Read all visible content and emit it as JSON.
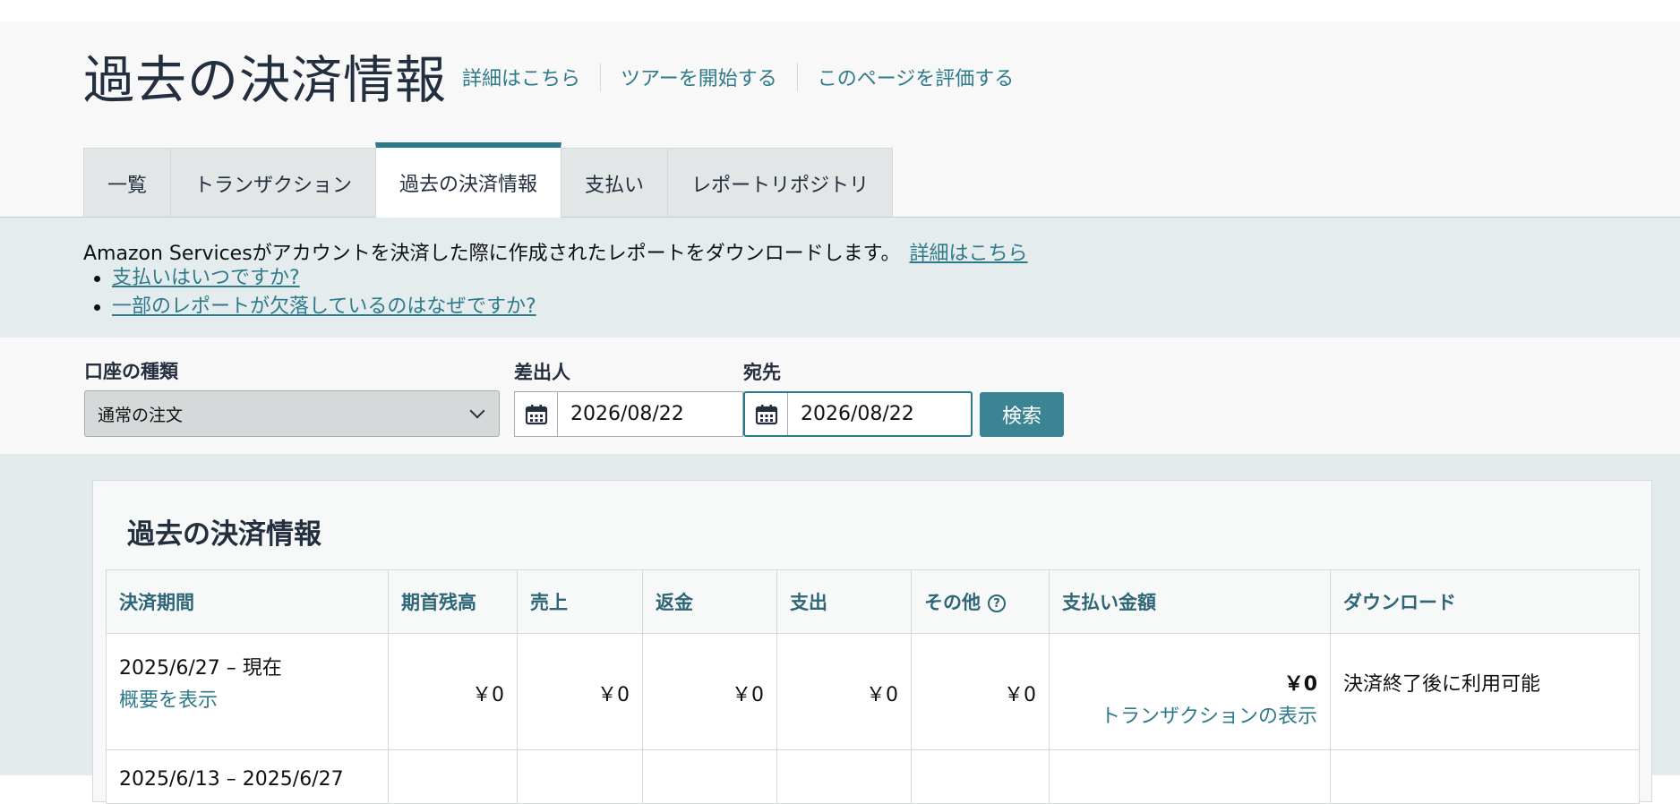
{
  "header": {
    "title": "過去の決済情報",
    "links": [
      "詳細はこちら",
      "ツアーを開始する",
      "このページを評価する"
    ]
  },
  "tabs": [
    {
      "label": "一覧",
      "active": false
    },
    {
      "label": "トランザクション",
      "active": false
    },
    {
      "label": "過去の決済情報",
      "active": true
    },
    {
      "label": "支払い",
      "active": false
    },
    {
      "label": "レポートリポジトリ",
      "active": false
    }
  ],
  "info": {
    "text": "Amazon Servicesがアカウントを決済した際に作成されたレポートをダウンロードします。",
    "link": "詳細はこちら",
    "bullets": [
      "支払いはいつですか?",
      "一部のレポートが欠落しているのはなぜですか?"
    ]
  },
  "filters": {
    "account_type_label": "口座の種類",
    "account_type_value": "通常の注文",
    "from_label": "差出人",
    "from_value": "2026/08/22",
    "to_label": "宛先",
    "to_value": "2026/08/22",
    "search_label": "検索"
  },
  "settlements": {
    "title": "過去の決済情報",
    "columns": [
      "決済期間",
      "期首残高",
      "売上",
      "返金",
      "支出",
      "その他",
      "支払い金額",
      "ダウンロード"
    ],
    "help_glyph": "?",
    "rows": [
      {
        "period": "2025/6/27 – 現在",
        "summary_link": "概要を表示",
        "opening_balance": "￥0",
        "sales": "￥0",
        "refunds": "￥0",
        "expenses": "￥0",
        "other": "￥0",
        "payout": "￥0",
        "transactions_link": "トランザクションの表示",
        "download": "決済終了後に利用可能"
      },
      {
        "period": "2025/6/13 – 2025/6/27"
      }
    ]
  },
  "colors": {
    "accent": "#2b7a8c",
    "link": "#2e7a8a",
    "button": "#3b8493",
    "info_band": "#e4ecee"
  }
}
